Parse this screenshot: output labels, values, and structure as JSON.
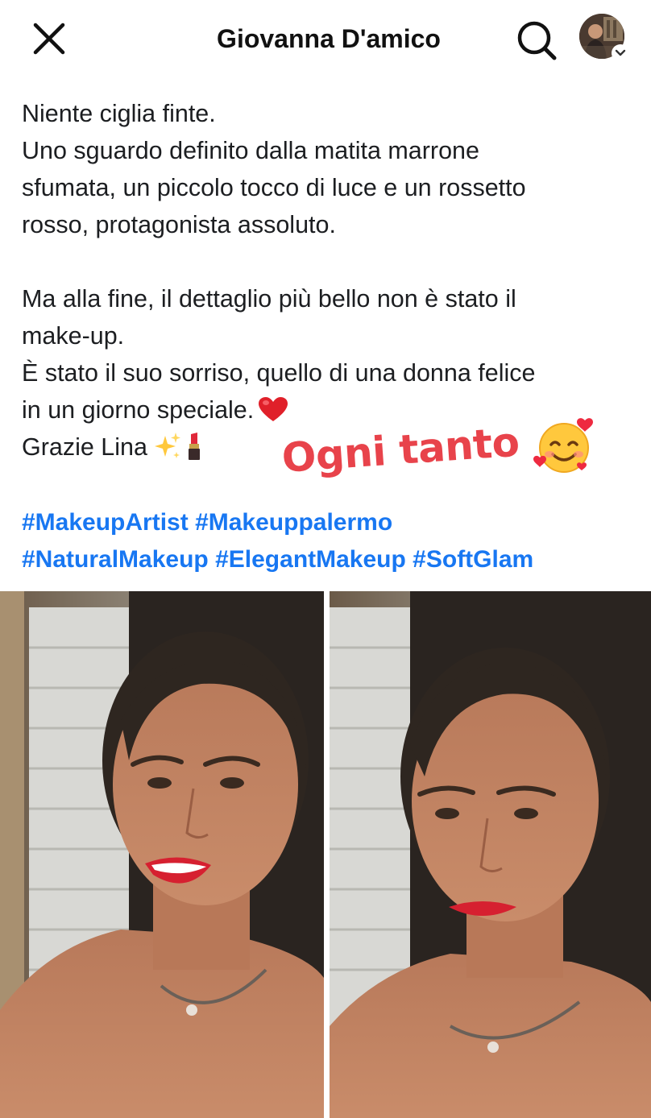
{
  "header": {
    "title": "Giovanna D'amico",
    "close_icon": "close-icon",
    "search_icon": "search-icon",
    "avatar_icon": "avatar"
  },
  "post": {
    "lines_block1": [
      "Niente ciglia finte.",
      "Uno sguardo definito dalla matita marrone",
      "sfumata, un piccolo tocco di luce e un rossetto",
      "rosso, protagonista assoluto."
    ],
    "lines_block2": [
      "Ma alla fine, il dettaglio più bello non è stato il",
      "make-up.",
      "È stato il suo sorriso, quello di una donna felice",
      "in un giorno speciale."
    ],
    "thanks": "Grazie Lina",
    "emojis": [
      "heart-icon",
      "sparkles-icon",
      "lipstick-icon"
    ]
  },
  "overlay": {
    "text": "Ogni tanto",
    "emoji": "smiling-face-with-hearts-icon",
    "color": "#e8434b"
  },
  "hashtags": {
    "row1": [
      "#MakeupArtist",
      "#Makeuppalermo"
    ],
    "row2": [
      "#NaturalMakeup",
      "#ElegantMakeup",
      "#SoftGlam"
    ],
    "color": "#1877f2"
  },
  "photos": [
    {
      "name": "photo-smiling"
    },
    {
      "name": "photo-neutral"
    }
  ]
}
